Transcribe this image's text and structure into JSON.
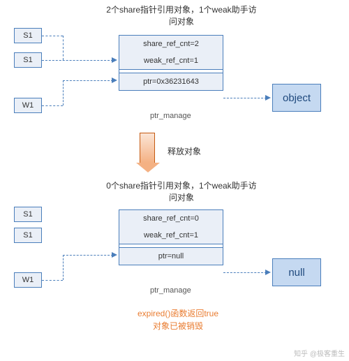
{
  "top": {
    "title": "2个share指针引用对象，1个weak助手访问对象",
    "pointers": {
      "s1a": "S1",
      "s1b": "S1",
      "w1": "W1"
    },
    "manage": {
      "share_ref": "share_ref_cnt=2",
      "weak_ref": "weak_ref_cnt=1",
      "ptr": "ptr=0x36231643",
      "label": "ptr_manage"
    },
    "object": "object"
  },
  "transition": {
    "label": "释放对象"
  },
  "bottom": {
    "title": "0个share指针引用对象，1个weak助手访问对象",
    "pointers": {
      "s1a": "S1",
      "s1b": "S1",
      "w1": "W1"
    },
    "manage": {
      "share_ref": "share_ref_cnt=0",
      "weak_ref": "weak_ref_cnt=1",
      "ptr": "ptr=null",
      "label": "ptr_manage"
    },
    "object": "null"
  },
  "expired": {
    "line1": "expired()函数返回true",
    "line2": "对象已被销毁"
  },
  "watermark": "知乎 @极客重生"
}
